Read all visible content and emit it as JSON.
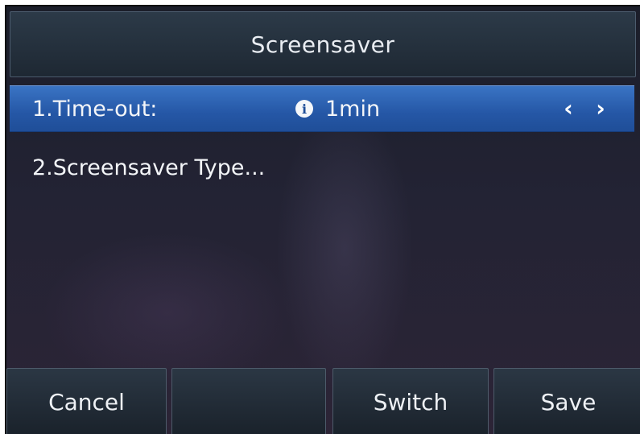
{
  "header": {
    "title": "Screensaver"
  },
  "menu": {
    "items": [
      {
        "label": "1.Time-out:",
        "value": "1min",
        "selected": true
      },
      {
        "label": "2.Screensaver Type...",
        "selected": false
      }
    ],
    "nav_left": "‹",
    "nav_right": "›",
    "info_glyph": "i"
  },
  "softkeys": {
    "key1": "Cancel",
    "key2": "",
    "key3": "Switch",
    "key4": "Save"
  },
  "colors": {
    "selection": "#2a5ead",
    "title_bar": "#26313d",
    "background": "#232334"
  }
}
